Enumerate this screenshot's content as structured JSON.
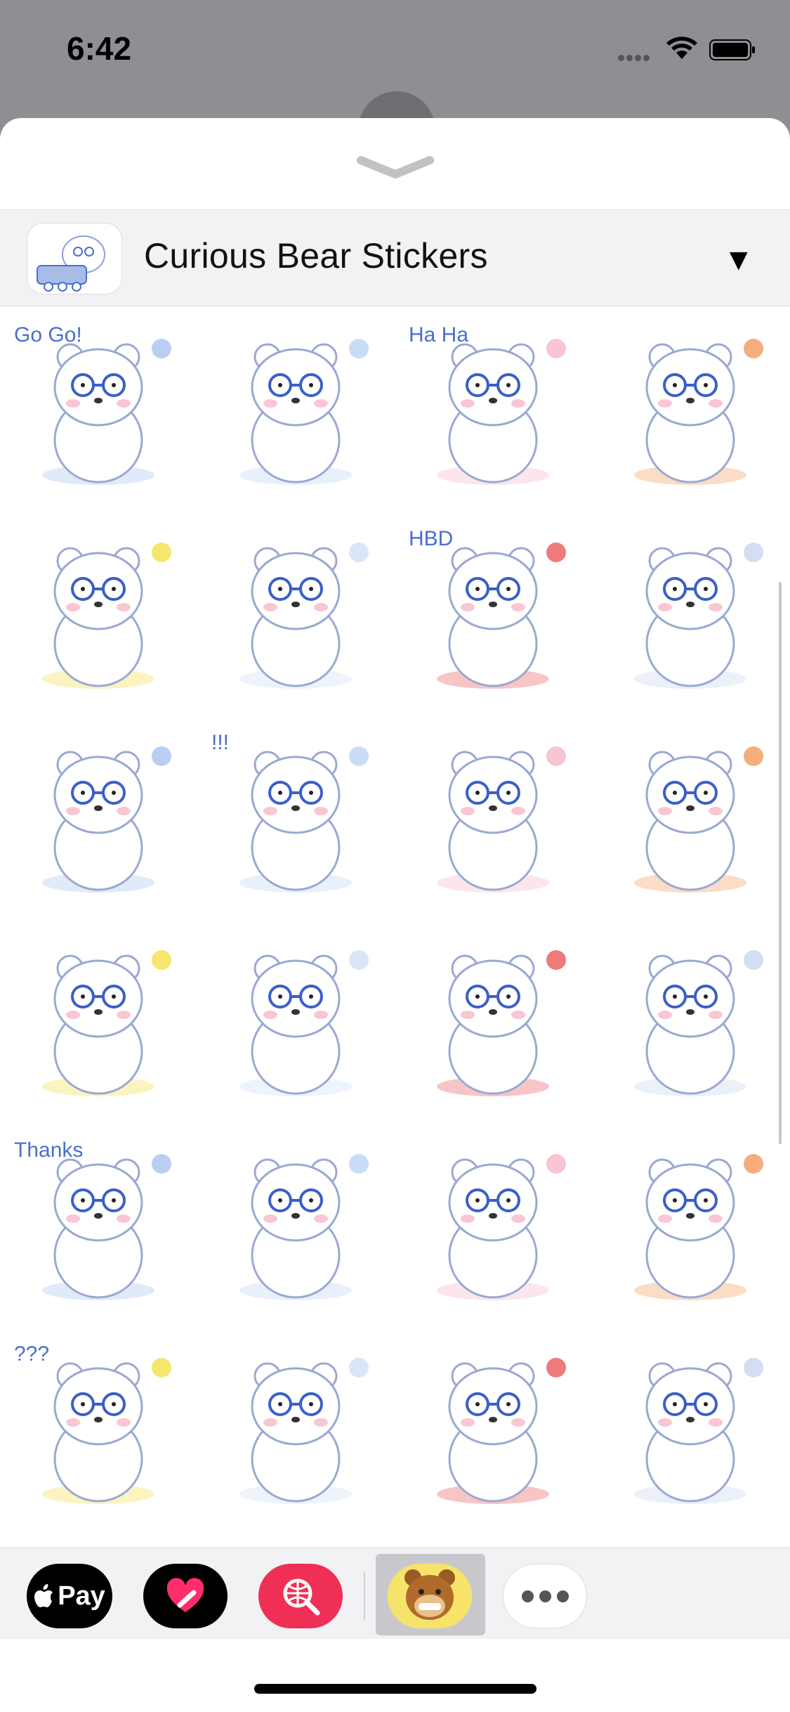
{
  "status_bar": {
    "time": "6:42"
  },
  "sheet": {
    "app_title": "Curious Bear Stickers",
    "expand_symbol": "▼"
  },
  "sticker_grid": {
    "columns": 4,
    "stickers": [
      {
        "name": "bear-train",
        "caption": "Go Go!"
      },
      {
        "name": "bear-hearts-bubbles"
      },
      {
        "name": "bear-laugh",
        "caption": "Ha Ha"
      },
      {
        "name": "bear-campfire-fish"
      },
      {
        "name": "bear-xray-skeleton"
      },
      {
        "name": "bear-eating-bowls"
      },
      {
        "name": "bear-birthday-cake",
        "caption": "HBD"
      },
      {
        "name": "bear-dash-right"
      },
      {
        "name": "bear-dash-left"
      },
      {
        "name": "bear-frozen",
        "caption": "!!!"
      },
      {
        "name": "bear-angry-steam"
      },
      {
        "name": "bear-crying-fountain"
      },
      {
        "name": "bear-hula-hoop"
      },
      {
        "name": "bear-upside-down"
      },
      {
        "name": "bear-snowman"
      },
      {
        "name": "bear-pink-heart-box"
      },
      {
        "name": "bear-thanks",
        "caption": "Thanks"
      },
      {
        "name": "bear-heart-thought"
      },
      {
        "name": "bear-shy-sparkle"
      },
      {
        "name": "bear-nosebleed-hearts"
      },
      {
        "name": "bear-confused",
        "caption": "???"
      },
      {
        "name": "bear-ghost-faint"
      },
      {
        "name": "bear-peace-sparkle"
      },
      {
        "name": "bear-blush-hearts"
      }
    ]
  },
  "drawer": {
    "apple_pay_label": "Pay",
    "apps": [
      "apple-pay",
      "digital-touch",
      "image-search",
      "curious-bear-stickers",
      "more"
    ]
  }
}
